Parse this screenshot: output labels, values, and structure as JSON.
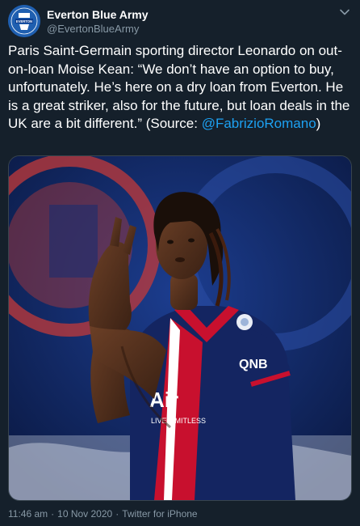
{
  "account": {
    "display_name": "Everton Blue Army",
    "handle": "@EvertonBlueArmy",
    "avatar_text": "EVERTON"
  },
  "tweet": {
    "text_main": "Paris Saint-Germain sporting director Leonardo on out-on-loan Moise Kean: “We don’t have an option to buy, unfortunately. He’s here on a dry loan from Everton. He is a great striker, also for the future, but loan deals in the UK are a bit different.” (Source: ",
    "mention": "@FabrizioRomano",
    "text_end": ")"
  },
  "media": {
    "shirt_sponsor": "QNB",
    "shirt_text_1": "Air",
    "shirt_text_2": "LIVE LIMITLESS"
  },
  "meta": {
    "time": "11:46 am",
    "separator": "·",
    "date": "10 Nov 2020",
    "source": "Twitter for iPhone"
  }
}
